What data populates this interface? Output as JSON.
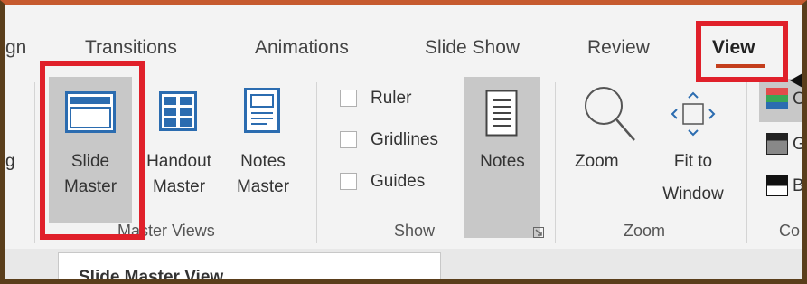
{
  "tabs": {
    "design_fragment": "gn",
    "transitions": "Transitions",
    "animations": "Animations",
    "slide_show": "Slide Show",
    "review": "Review",
    "view": "View"
  },
  "master_views": {
    "slide_master_line1": "Slide",
    "slide_master_line2": "Master",
    "handout_master_line1": "Handout",
    "handout_master_line2": "Master",
    "notes_master_line1": "Notes",
    "notes_master_line2": "Master",
    "group_label": "Master Views",
    "left_fragment": "g"
  },
  "show": {
    "ruler": "Ruler",
    "gridlines": "Gridlines",
    "guides": "Guides",
    "notes": "Notes",
    "group_label": "Show"
  },
  "zoom": {
    "zoom": "Zoom",
    "fit_line1": "Fit to",
    "fit_line2": "Window",
    "group_label": "Zoom"
  },
  "color": {
    "color_fragment": "C",
    "grayscale_fragment": "G",
    "bw_fragment": "B",
    "group_label_fragment": "Co"
  },
  "tooltip": {
    "title": "Slide Master View"
  },
  "colors": {
    "highlight": "#e0202a",
    "accent_underline": "#c43e1c",
    "icon_blue": "#2b6cb0"
  }
}
